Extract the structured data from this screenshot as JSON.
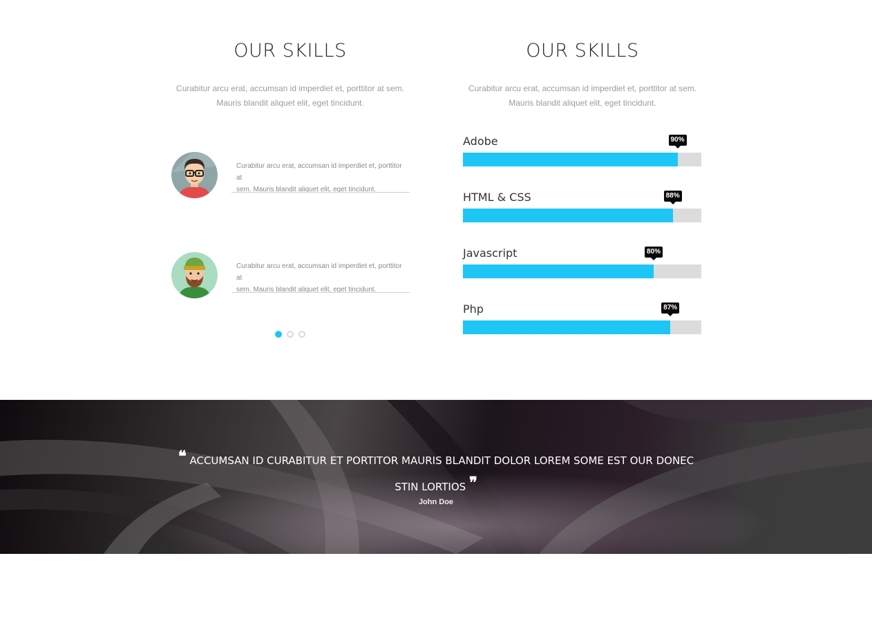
{
  "left": {
    "title": "OUR SKILLS",
    "subtitle_line1": "Curabitur arcu erat, accumsan id imperdiet et, porttitor at sem.",
    "subtitle_line2": "Mauris blandit aliquet elit, eget tincidunt.",
    "testimonials": [
      {
        "line1": "Curabitur arcu erat, accumsan id imperdiet et, porttitor at",
        "line2": "sem. Mauris blandit aliquet elit, eget tincidunt.",
        "avatar": "man-glasses-avatar"
      },
      {
        "line1": "Curabitur arcu erat, accumsan id imperdiet et, porttitor at",
        "line2": "sem. Mauris blandit aliquet elit, eget tincidunt.",
        "avatar": "bearded-man-beanie-avatar"
      }
    ],
    "carousel": {
      "pages": 3,
      "active": 0
    }
  },
  "right": {
    "title": "OUR SKILLS",
    "subtitle_line1": "Curabitur arcu erat, accumsan id imperdiet et, porttitor at sem.",
    "subtitle_line2": "Mauris blandit aliquet elit, eget tincidunt.",
    "skills": [
      {
        "name": "Adobe",
        "percent": 90,
        "label": "90%"
      },
      {
        "name": "HTML & CSS",
        "percent": 88,
        "label": "88%"
      },
      {
        "name": "Javascript",
        "percent": 80,
        "label": "80%"
      },
      {
        "name": "Php",
        "percent": 87,
        "label": "87%"
      }
    ]
  },
  "banner": {
    "quote_open": "❝",
    "quote_line1": "ACCUMSAN ID CURABITUR ET PORTITOR MAURIS BLANDIT DOLOR LOREM SOME EST OUR DONEC",
    "quote_line2": "STIN LORTIOS",
    "quote_close": "❞",
    "author": "John Doe"
  },
  "colors": {
    "accent": "#1ec6f5",
    "bar_track": "#dcdcdc",
    "tooltip": "#0a0a0a"
  }
}
